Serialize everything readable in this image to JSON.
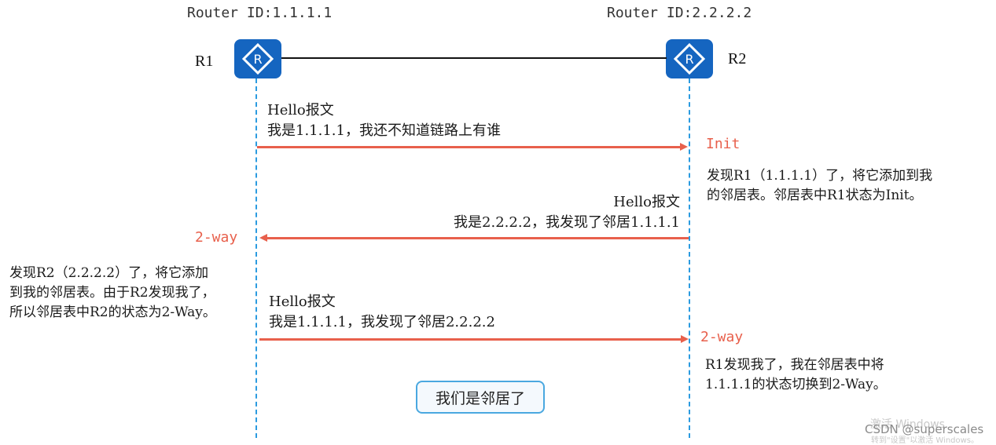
{
  "routers": {
    "r1": {
      "name": "R1",
      "router_id": "Router ID:1.1.1.1",
      "icon": "router-icon"
    },
    "r2": {
      "name": "R2",
      "router_id": "Router ID:2.2.2.2",
      "icon": "router-icon"
    }
  },
  "colors": {
    "router": "#1565c0",
    "lifeline": "#2b9be0",
    "arrow": "#e8604c",
    "state": "#e8604c",
    "badge_border": "#4aa8e0"
  },
  "messages": [
    {
      "direction": "R1->R2",
      "title": "Hello报文",
      "body": "我是1.1.1.1，我还不知道链路上有谁"
    },
    {
      "direction": "R2->R1",
      "title": "Hello报文",
      "body": "我是2.2.2.2，我发现了邻居1.1.1.1"
    },
    {
      "direction": "R1->R2",
      "title": "Hello报文",
      "body": "我是1.1.1.1，我发现了邻居2.2.2.2"
    }
  ],
  "states": {
    "r2_init": "Init",
    "r1_2way": "2-way",
    "r2_2way": "2-way"
  },
  "notes": {
    "r2_init": [
      "发现R1（1.1.1.1）了，将它添加到我",
      "的邻居表。邻居表中R1状态为Init。"
    ],
    "r1_2way": [
      "发现R2（2.2.2.2）了，将它添加",
      "到我的邻居表。由于R2发现我了，",
      "所以邻居表中R2的状态为2-Way。"
    ],
    "r2_2way": [
      "R1发现我了，我在邻居表中将",
      "1.1.1.1的状态切换到2-Way。"
    ]
  },
  "result_badge": "我们是邻居了",
  "watermark": {
    "activate": "激活 Windows",
    "csdn": "CSDN @superscales",
    "hint": "转到\"设置\"以激活 Windows。"
  }
}
